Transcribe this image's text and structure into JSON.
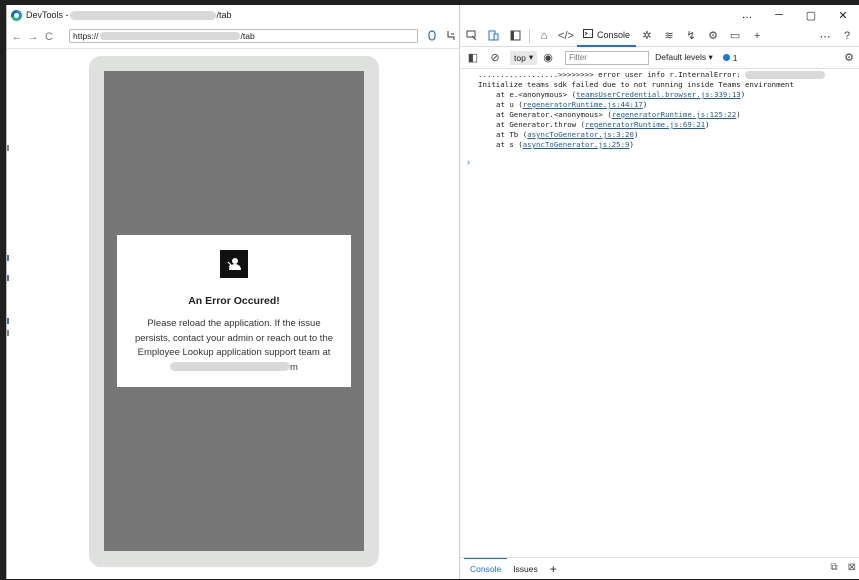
{
  "browser": {
    "title_prefix": "DevTools -",
    "title_suffix": "/tab",
    "url_prefix": "https://",
    "url_suffix": "/tab",
    "back": "←",
    "forward": "→",
    "reload": "C"
  },
  "error_card": {
    "title": "An Error Occured!",
    "message_part1": "Please reload the application. If the issue persists, contact your admin or reach out to the Employee Lookup application support team at ",
    "message_part2": "m"
  },
  "devtools": {
    "window_controls": [
      "…",
      "─",
      "▢",
      "✕"
    ],
    "tabs": {
      "console": "Console"
    },
    "toolbar": {
      "context": "top",
      "filter_placeholder": "Filter",
      "levels": "Default levels",
      "issues_count": "1"
    },
    "console_lines": {
      "line1": "..................>>>>>>>> error user info r.InternalError: ",
      "line2": "Initialize teams sdk failed due to not running inside Teams environment",
      "frames": [
        {
          "prefix": "at e.<anonymous> (",
          "link": "teamsUserCredential.browser.js:339:13",
          "suffix": ")"
        },
        {
          "prefix": "at u (",
          "link": "regeneratorRuntime.js:44:17",
          "suffix": ")"
        },
        {
          "prefix": "at Generator.<anonymous> (",
          "link": "regeneratorRuntime.js:125:22",
          "suffix": ")"
        },
        {
          "prefix": "at Generator.throw (",
          "link": "regeneratorRuntime.js:69:21",
          "suffix": ")"
        },
        {
          "prefix": "at Tb (",
          "link": "asyncToGenerator.js:3:20",
          "suffix": ")"
        },
        {
          "prefix": "at s (",
          "link": "asyncToGenerator.js:25:9",
          "suffix": ")"
        }
      ],
      "prompt": "›"
    },
    "bottom_tabs": {
      "console": "Console",
      "issues": "Issues",
      "add": "+"
    }
  },
  "colors": {
    "accent": "#1a73e8",
    "link": "#1a5fb4",
    "device_frame": "#dfe1de",
    "screen_bg": "#777777"
  },
  "icons": [
    "edge-icon",
    "lock-icon",
    "share-icon",
    "device-toggle-icon",
    "inspect-icon",
    "dock-icon",
    "home-icon",
    "elements-icon",
    "console-icon",
    "bug-icon",
    "wifi-icon",
    "performance-icon",
    "gear-icon",
    "panel-icon",
    "plus-icon",
    "more-icon",
    "help-icon",
    "clear-console-icon",
    "sidebar-icon",
    "eye-icon",
    "dock-bottom-icon",
    "expand-icon",
    "user-logo-icon"
  ]
}
